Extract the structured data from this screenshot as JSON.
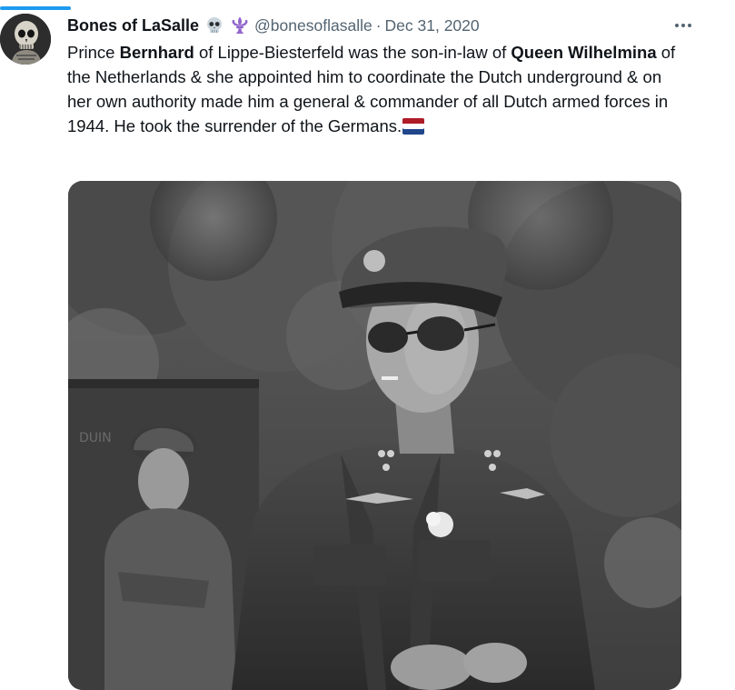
{
  "tweet": {
    "display_name": "Bones of LaSalle",
    "name_emojis": [
      "skull-emoji",
      "fleur-de-lis-emoji"
    ],
    "handle": "@bonesoflasalle",
    "separator": "·",
    "date": "Dec 31, 2020",
    "more_label": "···",
    "text_parts": {
      "p1": "Prince ",
      "b1": "Bernhard",
      "p2": " of Lippe-Biesterfeld was the son-in-law of ",
      "b2": "Queen Wilhelmina",
      "p3": " of the Netherlands & she appointed him to coordinate the Dutch underground & on her own authority made him a general & commander of all Dutch armed forces in 1944. He took the surrender of the Germans."
    },
    "flag_emoji": "netherlands-flag",
    "media": {
      "type": "black-and-white-photo",
      "visible_text": "DUIN"
    }
  },
  "colors": {
    "accent": "#1d9bf0",
    "text_primary": "#0f1419",
    "text_secondary": "#536471",
    "flag_red": "#ae1c28",
    "flag_white": "#ffffff",
    "flag_blue": "#21468b"
  }
}
